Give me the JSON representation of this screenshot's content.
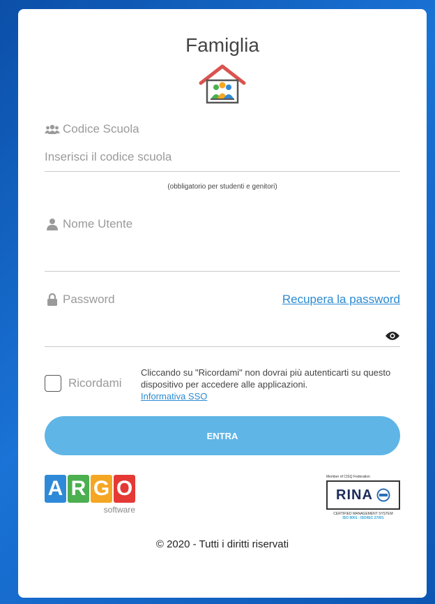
{
  "header": {
    "title": "Famiglia"
  },
  "school": {
    "label": "Codice Scuola",
    "placeholder": "Inserisci il codice scuola",
    "value": "",
    "note": "(obbligatorio per studenti e genitori)"
  },
  "username": {
    "label": "Nome Utente",
    "value": ""
  },
  "password": {
    "label": "Password",
    "recover_link": "Recupera la password",
    "value": ""
  },
  "remember": {
    "label": "Ricordami",
    "description": "Cliccando su \"Ricordami\" non dovrai più autenticarti su questo dispositivo per accedere alle applicazioni.",
    "link": "Informativa SSO"
  },
  "login_button": {
    "label": "ENTRA"
  },
  "argo_logo": {
    "letters": [
      "A",
      "R",
      "G",
      "O"
    ],
    "subtitle": "software",
    "colors": [
      "#2e8ad8",
      "#4caf50",
      "#f5a623",
      "#e53935"
    ]
  },
  "rina_logo": {
    "top_text": "Member of CISQ Federation",
    "brand": "RINA",
    "bottom_text": "CERTIFIED MANAGEMENT SYSTEM",
    "iso_text": "ISO 9001 - ISO/IEC 27001"
  },
  "footer": {
    "copyright": "© 2020 - Tutti i diritti riservati"
  },
  "colors": {
    "accent": "#5fb5e6",
    "link": "#2a8ad1",
    "background": "#1a73d6"
  },
  "icons": [
    "family-house-icon",
    "users-icon",
    "user-icon",
    "lock-icon",
    "eye-icon"
  ]
}
